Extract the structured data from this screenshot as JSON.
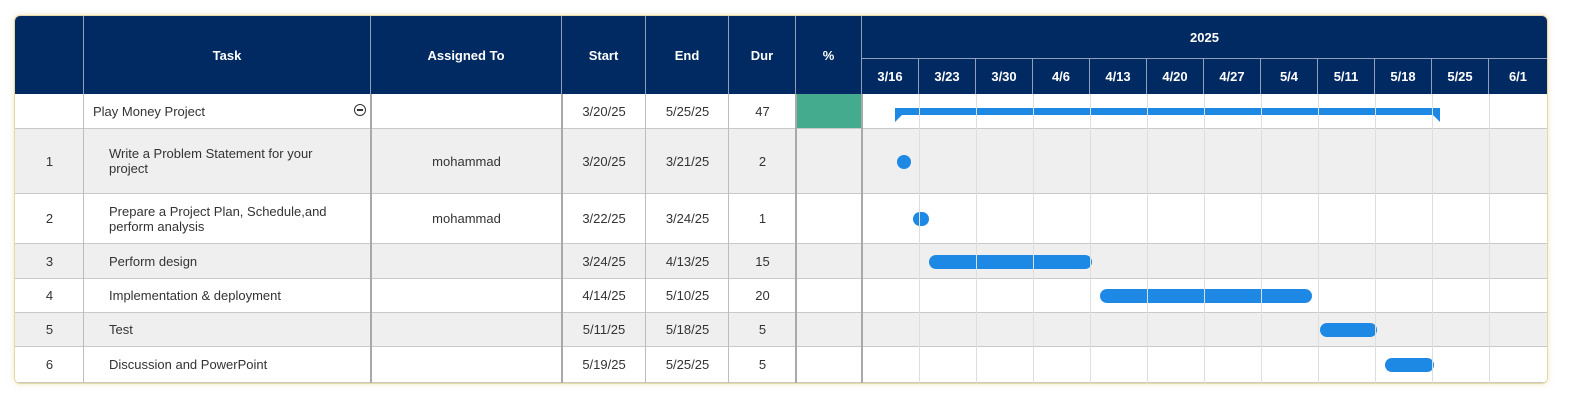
{
  "columns": {
    "task": "Task",
    "assigned": "Assigned To",
    "start": "Start",
    "end": "End",
    "dur": "Dur",
    "pct": "%"
  },
  "timeline": {
    "year": "2025",
    "weeks": [
      "3/16",
      "3/23",
      "3/30",
      "4/6",
      "4/13",
      "4/20",
      "4/27",
      "5/4",
      "5/11",
      "5/18",
      "5/25",
      "6/1"
    ]
  },
  "summary": {
    "name": "Play Money Project",
    "start": "3/20/25",
    "end": "5/25/25",
    "dur": "47",
    "percent_fill_color": "#44ab8e"
  },
  "tasks": [
    {
      "id": "1",
      "name": "Write a Problem Statement for your project",
      "assigned": "mohammad",
      "start": "3/20/25",
      "end": "3/21/25",
      "dur": "2"
    },
    {
      "id": "2",
      "name": "Prepare a Project Plan, Schedule,and perform analysis",
      "assigned": "mohammad",
      "start": "3/22/25",
      "end": "3/24/25",
      "dur": "1"
    },
    {
      "id": "3",
      "name": "Perform design",
      "assigned": "",
      "start": "3/24/25",
      "end": "4/13/25",
      "dur": "15"
    },
    {
      "id": "4",
      "name": "Implementation & deployment",
      "assigned": "",
      "start": "4/14/25",
      "end": "5/10/25",
      "dur": "20"
    },
    {
      "id": "5",
      "name": "Test",
      "assigned": "",
      "start": "5/11/25",
      "end": "5/18/25",
      "dur": "5"
    },
    {
      "id": "6",
      "name": "Discussion and PowerPoint",
      "assigned": "",
      "start": "5/19/25",
      "end": "5/25/25",
      "dur": "5"
    }
  ],
  "colors": {
    "header_bg": "#002a61",
    "bar": "#1e88e5",
    "row_alt": "#efefef"
  },
  "icons": {
    "summary_toggle": "collapse-minus-icon"
  }
}
